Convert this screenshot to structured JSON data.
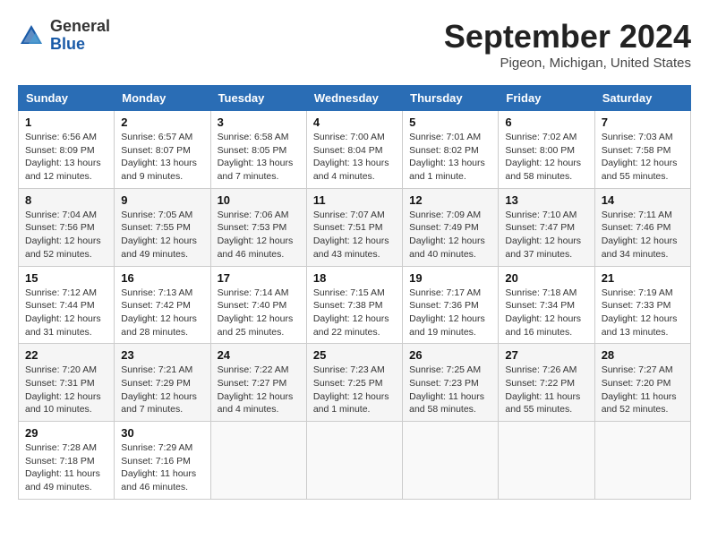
{
  "header": {
    "logo_general": "General",
    "logo_blue": "Blue",
    "month": "September 2024",
    "location": "Pigeon, Michigan, United States"
  },
  "columns": [
    "Sunday",
    "Monday",
    "Tuesday",
    "Wednesday",
    "Thursday",
    "Friday",
    "Saturday"
  ],
  "weeks": [
    [
      {
        "day": "1",
        "info": "Sunrise: 6:56 AM\nSunset: 8:09 PM\nDaylight: 13 hours\nand 12 minutes."
      },
      {
        "day": "2",
        "info": "Sunrise: 6:57 AM\nSunset: 8:07 PM\nDaylight: 13 hours\nand 9 minutes."
      },
      {
        "day": "3",
        "info": "Sunrise: 6:58 AM\nSunset: 8:05 PM\nDaylight: 13 hours\nand 7 minutes."
      },
      {
        "day": "4",
        "info": "Sunrise: 7:00 AM\nSunset: 8:04 PM\nDaylight: 13 hours\nand 4 minutes."
      },
      {
        "day": "5",
        "info": "Sunrise: 7:01 AM\nSunset: 8:02 PM\nDaylight: 13 hours\nand 1 minute."
      },
      {
        "day": "6",
        "info": "Sunrise: 7:02 AM\nSunset: 8:00 PM\nDaylight: 12 hours\nand 58 minutes."
      },
      {
        "day": "7",
        "info": "Sunrise: 7:03 AM\nSunset: 7:58 PM\nDaylight: 12 hours\nand 55 minutes."
      }
    ],
    [
      {
        "day": "8",
        "info": "Sunrise: 7:04 AM\nSunset: 7:56 PM\nDaylight: 12 hours\nand 52 minutes."
      },
      {
        "day": "9",
        "info": "Sunrise: 7:05 AM\nSunset: 7:55 PM\nDaylight: 12 hours\nand 49 minutes."
      },
      {
        "day": "10",
        "info": "Sunrise: 7:06 AM\nSunset: 7:53 PM\nDaylight: 12 hours\nand 46 minutes."
      },
      {
        "day": "11",
        "info": "Sunrise: 7:07 AM\nSunset: 7:51 PM\nDaylight: 12 hours\nand 43 minutes."
      },
      {
        "day": "12",
        "info": "Sunrise: 7:09 AM\nSunset: 7:49 PM\nDaylight: 12 hours\nand 40 minutes."
      },
      {
        "day": "13",
        "info": "Sunrise: 7:10 AM\nSunset: 7:47 PM\nDaylight: 12 hours\nand 37 minutes."
      },
      {
        "day": "14",
        "info": "Sunrise: 7:11 AM\nSunset: 7:46 PM\nDaylight: 12 hours\nand 34 minutes."
      }
    ],
    [
      {
        "day": "15",
        "info": "Sunrise: 7:12 AM\nSunset: 7:44 PM\nDaylight: 12 hours\nand 31 minutes."
      },
      {
        "day": "16",
        "info": "Sunrise: 7:13 AM\nSunset: 7:42 PM\nDaylight: 12 hours\nand 28 minutes."
      },
      {
        "day": "17",
        "info": "Sunrise: 7:14 AM\nSunset: 7:40 PM\nDaylight: 12 hours\nand 25 minutes."
      },
      {
        "day": "18",
        "info": "Sunrise: 7:15 AM\nSunset: 7:38 PM\nDaylight: 12 hours\nand 22 minutes."
      },
      {
        "day": "19",
        "info": "Sunrise: 7:17 AM\nSunset: 7:36 PM\nDaylight: 12 hours\nand 19 minutes."
      },
      {
        "day": "20",
        "info": "Sunrise: 7:18 AM\nSunset: 7:34 PM\nDaylight: 12 hours\nand 16 minutes."
      },
      {
        "day": "21",
        "info": "Sunrise: 7:19 AM\nSunset: 7:33 PM\nDaylight: 12 hours\nand 13 minutes."
      }
    ],
    [
      {
        "day": "22",
        "info": "Sunrise: 7:20 AM\nSunset: 7:31 PM\nDaylight: 12 hours\nand 10 minutes."
      },
      {
        "day": "23",
        "info": "Sunrise: 7:21 AM\nSunset: 7:29 PM\nDaylight: 12 hours\nand 7 minutes."
      },
      {
        "day": "24",
        "info": "Sunrise: 7:22 AM\nSunset: 7:27 PM\nDaylight: 12 hours\nand 4 minutes."
      },
      {
        "day": "25",
        "info": "Sunrise: 7:23 AM\nSunset: 7:25 PM\nDaylight: 12 hours\nand 1 minute."
      },
      {
        "day": "26",
        "info": "Sunrise: 7:25 AM\nSunset: 7:23 PM\nDaylight: 11 hours\nand 58 minutes."
      },
      {
        "day": "27",
        "info": "Sunrise: 7:26 AM\nSunset: 7:22 PM\nDaylight: 11 hours\nand 55 minutes."
      },
      {
        "day": "28",
        "info": "Sunrise: 7:27 AM\nSunset: 7:20 PM\nDaylight: 11 hours\nand 52 minutes."
      }
    ],
    [
      {
        "day": "29",
        "info": "Sunrise: 7:28 AM\nSunset: 7:18 PM\nDaylight: 11 hours\nand 49 minutes."
      },
      {
        "day": "30",
        "info": "Sunrise: 7:29 AM\nSunset: 7:16 PM\nDaylight: 11 hours\nand 46 minutes."
      },
      null,
      null,
      null,
      null,
      null
    ]
  ]
}
